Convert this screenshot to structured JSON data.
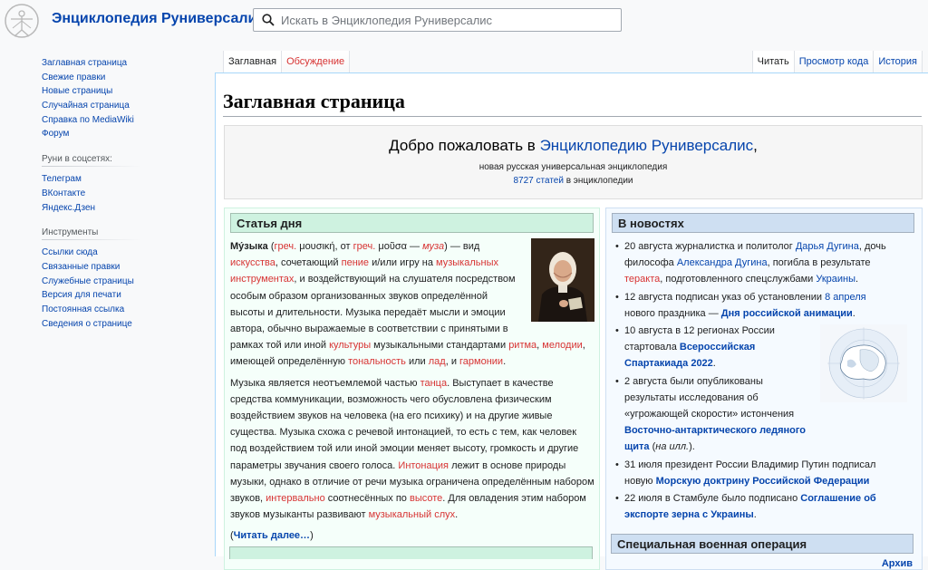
{
  "header": {
    "site_title": "Энциклопедия Руниверсалис",
    "search_placeholder": "Искать в Энциклопедия Руниверсалис"
  },
  "sidebar": {
    "nav": [
      "Заглавная страница",
      "Свежие правки",
      "Новые страницы",
      "Случайная страница",
      "Справка по MediaWiki",
      "Форум"
    ],
    "social_heading": "Руни в соцсетях:",
    "social": [
      "Телеграм",
      "ВКонтакте",
      "Яндекс.Дзен"
    ],
    "tools_heading": "Инструменты",
    "tools": [
      "Ссылки сюда",
      "Связанные правки",
      "Служебные страницы",
      "Версия для печати",
      "Постоянная ссылка",
      "Сведения о странице"
    ]
  },
  "tabs": {
    "left": [
      "Заглавная",
      "Обсуждение"
    ],
    "right": [
      "Читать",
      "Просмотр кода",
      "История"
    ]
  },
  "page": {
    "title": "Заглавная страница",
    "welcome_prefix": "Добро пожаловать в ",
    "welcome_link": "Энциклопедию Руниверсалис",
    "welcome_suffix": ",",
    "tagline": "новая русская универсальная энциклопедия",
    "articles_count": "8727 статей",
    "articles_suffix": " в энциклопедии"
  },
  "featured": {
    "heading": "Статья дня",
    "p1": [
      {
        "t": "Му́зыка",
        "b": true
      },
      {
        "t": " ("
      },
      {
        "t": "греч.",
        "c": "red"
      },
      {
        "t": " μουσική, от "
      },
      {
        "t": "греч.",
        "c": "red"
      },
      {
        "t": " μοῦσα — "
      },
      {
        "t": "муза",
        "c": "red",
        "i": true
      },
      {
        "t": ") — вид "
      },
      {
        "t": "искусства",
        "c": "red"
      },
      {
        "t": ", сочетающий "
      },
      {
        "t": "пение",
        "c": "red"
      },
      {
        "t": " и/или игру на "
      },
      {
        "t": "музыкальных инструментах",
        "c": "red"
      },
      {
        "t": ", и воздействующий на слушателя посредством особым образом организованных звуков определённой высоты и длительности. Музыка передаёт мысли и эмоции автора, обычно выражаемые в соответствии с принятыми в рамках той или иной "
      },
      {
        "t": "культуры",
        "c": "red"
      },
      {
        "t": " музыкальными стандартами "
      },
      {
        "t": "ритма",
        "c": "red"
      },
      {
        "t": ", "
      },
      {
        "t": "мелодии",
        "c": "red"
      },
      {
        "t": ", имеющей определённую "
      },
      {
        "t": "тональность",
        "c": "red"
      },
      {
        "t": " или "
      },
      {
        "t": "лад",
        "c": "red"
      },
      {
        "t": ", и "
      },
      {
        "t": "гармонии",
        "c": "red"
      },
      {
        "t": "."
      }
    ],
    "p2": [
      {
        "t": "Музыка является неотъемлемой частью "
      },
      {
        "t": "танца",
        "c": "red"
      },
      {
        "t": ". Выступает в качестве средства коммуникации, возможность чего обусловлена физическим воздействием звуков на человека (на его психику) и на другие живые существа. Музыка схожа с речевой интонацией, то есть с тем, как человек под воздействием той или иной эмоции меняет высоту, громкость и другие параметры звучания своего голоса. "
      },
      {
        "t": "Интонация",
        "c": "red"
      },
      {
        "t": " лежит в основе природы музыки, однако в отличие от речи музыка ограничена определённым набором звуков, "
      },
      {
        "t": "интервально",
        "c": "red"
      },
      {
        "t": " соотнесённых по "
      },
      {
        "t": "высоте",
        "c": "red"
      },
      {
        "t": ". Для овладения этим набором звуков музыканты развивают "
      },
      {
        "t": "музыкальный слух",
        "c": "red"
      },
      {
        "t": "."
      }
    ],
    "read_more_open": "(",
    "read_more": "Читать далее…",
    "read_more_close": ")"
  },
  "news": {
    "heading": "В новостях",
    "items": [
      [
        {
          "t": "20 августа журналистка и политолог "
        },
        {
          "t": "Дарья Дугина",
          "c": "link"
        },
        {
          "t": ", дочь философа "
        },
        {
          "t": "Александра Дугина",
          "c": "link"
        },
        {
          "t": ", погибла в результате "
        },
        {
          "t": "теракта",
          "c": "red"
        },
        {
          "t": ", подготовленного спецслужбами "
        },
        {
          "t": "Украины",
          "c": "link"
        },
        {
          "t": "."
        }
      ],
      [
        {
          "t": "12 августа подписан указ об установлении "
        },
        {
          "t": "8 апреля",
          "c": "link"
        },
        {
          "t": " нового праздника — "
        },
        {
          "t": "Дня российской анимации",
          "c": "link",
          "b": true
        },
        {
          "t": "."
        }
      ],
      [
        {
          "t": "10 августа в 12 регионах России стартовала "
        },
        {
          "t": "Всероссийская Спартакиада 2022",
          "c": "link",
          "b": true
        },
        {
          "t": "."
        }
      ],
      [
        {
          "t": "2 августа были опубликованы результаты исследования об «угрожающей скорости» истончения "
        },
        {
          "t": "Восточно-антарктического ледяного щита",
          "c": "link",
          "b": true
        },
        {
          "t": " ("
        },
        {
          "t": "на илл.",
          "i": true
        },
        {
          "t": ")."
        }
      ],
      [
        {
          "t": "31 июля президент России Владимир Путин подписал новую "
        },
        {
          "t": "Морскую доктрину Российской Федерации",
          "c": "link",
          "b": true
        }
      ],
      [
        {
          "t": "22 июля в Стамбуле было подписано "
        },
        {
          "t": "Соглашение об экспорте зерна с Украины",
          "c": "link",
          "b": true
        },
        {
          "t": "."
        }
      ]
    ],
    "archive": "Архив"
  },
  "svo_heading": "Специальная военная операция"
}
